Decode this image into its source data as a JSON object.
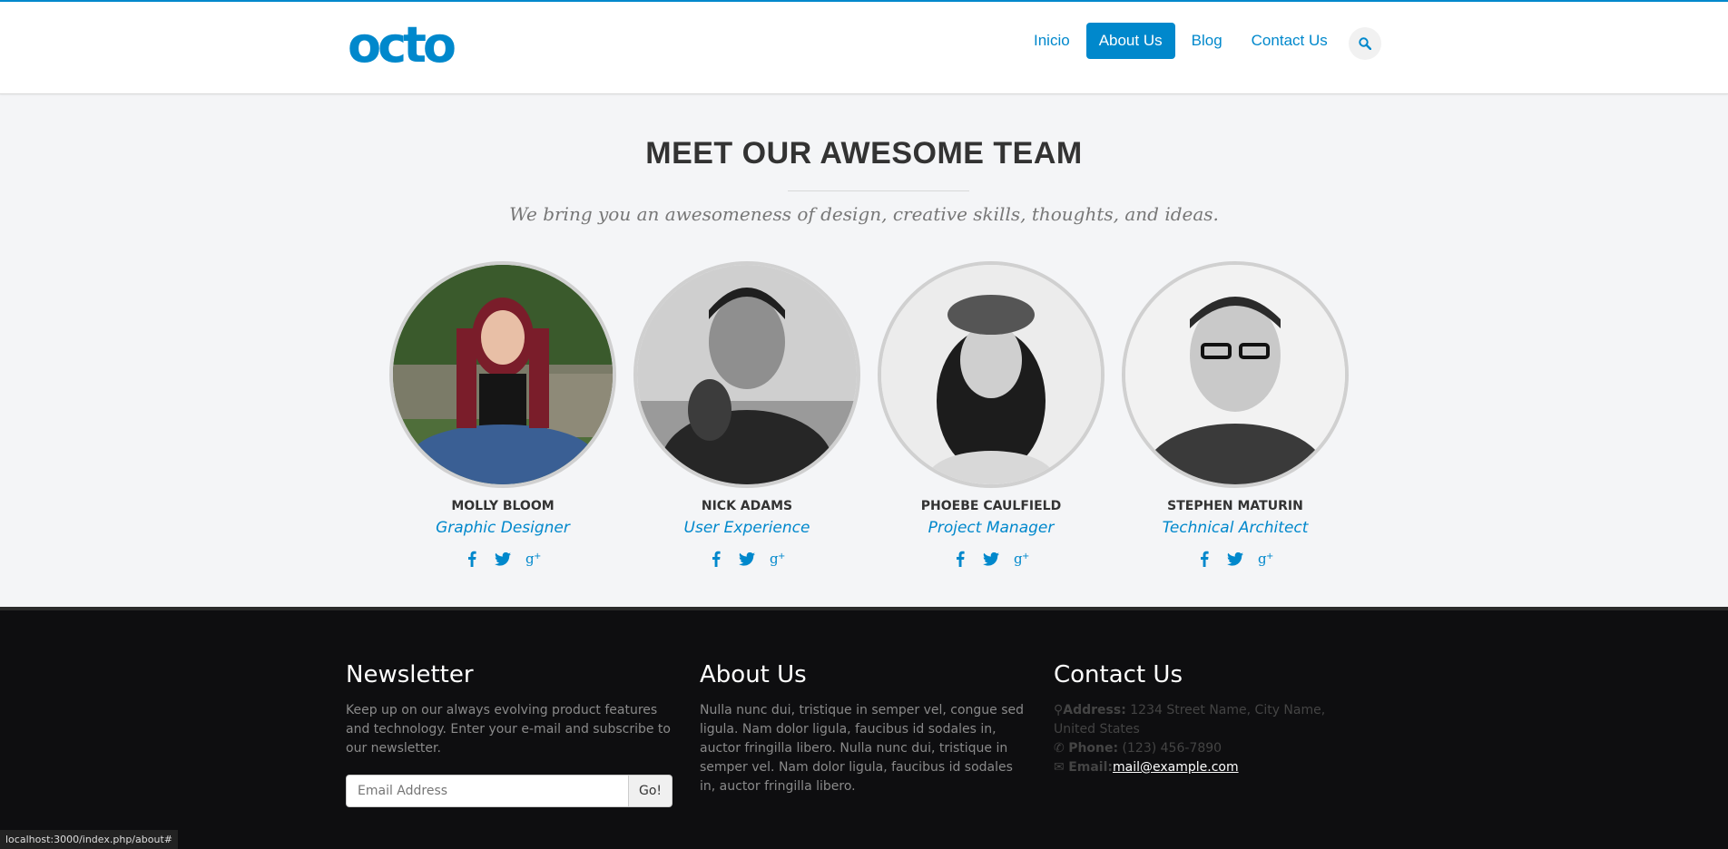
{
  "header": {
    "logo_text": "octo",
    "nav": [
      {
        "label": "Inicio",
        "active": false
      },
      {
        "label": "About Us",
        "active": true
      },
      {
        "label": "Blog",
        "active": false
      },
      {
        "label": "Contact Us",
        "active": false
      }
    ],
    "search_icon": "search-icon"
  },
  "team": {
    "title": "MEET OUR AWESOME TEAM",
    "subtitle": "We bring you an awesomeness of design, creative skills, thoughts, and ideas.",
    "members": [
      {
        "name": "MOLLY BLOOM",
        "role": "Graphic Designer"
      },
      {
        "name": "NICK ADAMS",
        "role": "User Experience"
      },
      {
        "name": "PHOEBE CAULFIELD",
        "role": "Project Manager"
      },
      {
        "name": "STEPHEN MATURIN",
        "role": "Technical Architect"
      }
    ],
    "social_icons": [
      "facebook-icon",
      "twitter-icon",
      "google-plus-icon"
    ]
  },
  "footer": {
    "newsletter": {
      "title": "Newsletter",
      "text": "Keep up on our always evolving product features and technology. Enter your e-mail and subscribe to our newsletter.",
      "placeholder": "Email Address",
      "button": "Go!"
    },
    "about": {
      "title": "About Us",
      "text": "Nulla nunc dui, tristique in semper vel, congue sed ligula. Nam dolor ligula, faucibus id sodales in, auctor fringilla libero. Nulla nunc dui, tristique in semper vel. Nam dolor ligula, faucibus id sodales in, auctor fringilla libero."
    },
    "contact": {
      "title": "Contact Us",
      "address_label": "Address:",
      "address": "1234 Street Name, City Name, United States",
      "phone_label": "Phone:",
      "phone": "(123) 456-7890",
      "email_label": "Email:",
      "email": "mail@example.com"
    }
  },
  "status_url": "localhost:3000/index.php/about#",
  "colors": {
    "accent": "#0088cc",
    "footer_bg": "#0e0e10",
    "page_bg": "#f4f5f7"
  }
}
